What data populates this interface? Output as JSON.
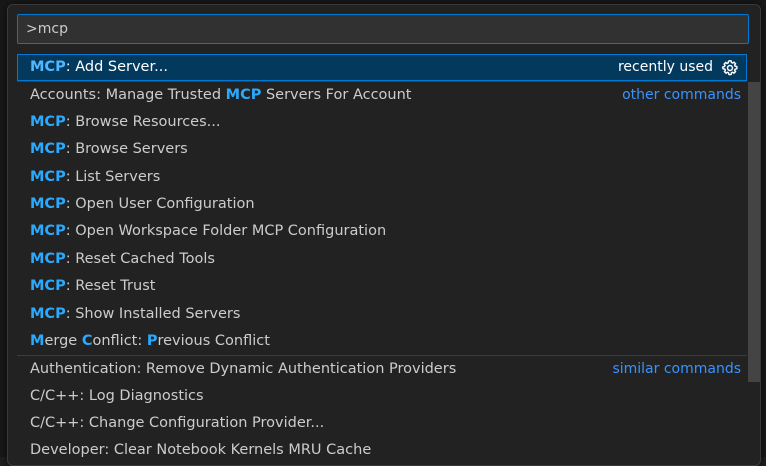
{
  "search": {
    "value": ">mcp",
    "placeholder": ""
  },
  "items": [
    {
      "segments": [
        {
          "t": "MCP",
          "h": true
        },
        {
          "t": ": Add Server...",
          "h": false
        }
      ],
      "tag": "recently used",
      "tag_style": "plain",
      "gear": true,
      "selected": true
    },
    {
      "segments": [
        {
          "t": "Accounts: Manage Trusted ",
          "h": false
        },
        {
          "t": "MCP",
          "h": true
        },
        {
          "t": " Servers For Account",
          "h": false
        }
      ],
      "tag": "other commands",
      "separator": true
    },
    {
      "segments": [
        {
          "t": "MCP",
          "h": true
        },
        {
          "t": ": Browse Resources...",
          "h": false
        }
      ]
    },
    {
      "segments": [
        {
          "t": "MCP",
          "h": true
        },
        {
          "t": ": Browse Servers",
          "h": false
        }
      ]
    },
    {
      "segments": [
        {
          "t": "MCP",
          "h": true
        },
        {
          "t": ": List Servers",
          "h": false
        }
      ]
    },
    {
      "segments": [
        {
          "t": "MCP",
          "h": true
        },
        {
          "t": ": Open User Configuration",
          "h": false
        }
      ]
    },
    {
      "segments": [
        {
          "t": "MCP",
          "h": true
        },
        {
          "t": ": Open Workspace Folder MCP Configuration",
          "h": false
        }
      ]
    },
    {
      "segments": [
        {
          "t": "MCP",
          "h": true
        },
        {
          "t": ": Reset Cached Tools",
          "h": false
        }
      ]
    },
    {
      "segments": [
        {
          "t": "MCP",
          "h": true
        },
        {
          "t": ": Reset Trust",
          "h": false
        }
      ]
    },
    {
      "segments": [
        {
          "t": "MCP",
          "h": true
        },
        {
          "t": ": Show Installed Servers",
          "h": false
        }
      ]
    },
    {
      "segments": [
        {
          "t": "M",
          "h": true
        },
        {
          "t": "erge ",
          "h": false
        },
        {
          "t": "C",
          "h": true
        },
        {
          "t": "onflict: ",
          "h": false
        },
        {
          "t": "P",
          "h": true
        },
        {
          "t": "revious Conflict",
          "h": false
        }
      ]
    },
    {
      "segments": [
        {
          "t": "Authentication: Remove Dynamic Authentication Providers",
          "h": false
        }
      ],
      "tag": "similar commands",
      "separator": true
    },
    {
      "segments": [
        {
          "t": "C/C++: Log Diagnostics",
          "h": false
        }
      ]
    },
    {
      "segments": [
        {
          "t": "C/C++: Change Configuration Provider...",
          "h": false
        }
      ]
    },
    {
      "segments": [
        {
          "t": "Developer: Clear Notebook Kernels MRU Cache",
          "h": false
        }
      ]
    }
  ],
  "colors": {
    "accent": "#0078d4",
    "highlight": "#2aaaff",
    "link": "#3794ff",
    "selected_bg": "#04395e"
  },
  "icons": {
    "gear": "gear-icon"
  }
}
